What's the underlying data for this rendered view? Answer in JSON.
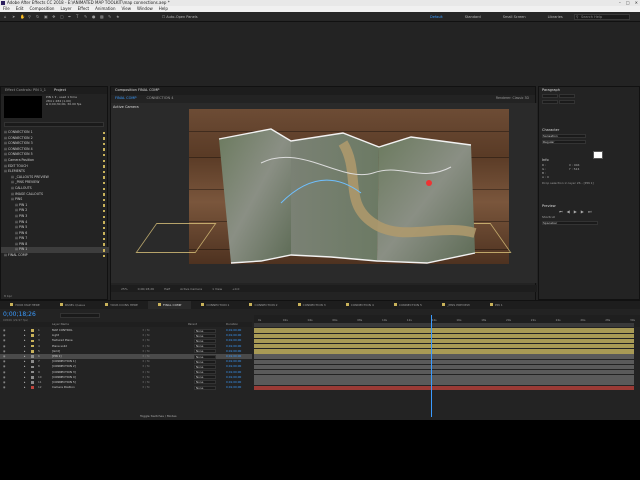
{
  "titlebar": {
    "title": "Adobe After Effects CC 2018 - E:\\ANIMATED MAP TOOLKIT\\map connections.aep *"
  },
  "menubar": [
    "File",
    "Edit",
    "Composition",
    "Layer",
    "Effect",
    "Animation",
    "View",
    "Window",
    "Help"
  ],
  "toolbar": {
    "auto_open": "Auto-Open Panels",
    "workspaces": [
      "Default",
      "Standard",
      "Small Screen",
      "Libraries"
    ],
    "search_placeholder": "Search Help"
  },
  "project_panel": {
    "tabs": [
      "Effect Controls: PIN 1_1",
      "Project"
    ],
    "info": [
      "PIN 1 ▾ , used 1 time",
      "284 x 284 (1.00)",
      "Δ 0;00;30;00, 30.00 fps"
    ],
    "items": [
      "CONNECTION 1",
      "CONNECTION 2",
      "CONNECTION 3",
      "CONNECTION 4",
      "CONNECTION 5",
      "Camera Position",
      "EDIT TOUCH",
      "ELEMENTS",
      "_CALLOUTS PREVIEW",
      "_PINS PREVIEW",
      "CALLOUTS",
      "IMAGE CALLOUTS",
      "PINS",
      "PIN 1",
      "PIN 2",
      "PIN 3",
      "PIN 4",
      "PIN 5",
      "PIN 6",
      "PIN 7",
      "PIN 8",
      "PIN 1",
      "FINAL COMP"
    ],
    "selected_index": 21,
    "bpc": "8 bpc"
  },
  "composition": {
    "tab": "Composition FINAL COMP",
    "subtabs": [
      "FINAL COMP",
      "CONNECTION 4"
    ],
    "renderer": "Renderer:",
    "renderer_value": "Classic 3D",
    "camera_label": "Active Camera",
    "controls": [
      "25%",
      "0;00;18;26",
      "Half",
      "Active Camera",
      "1 View",
      "+0.0"
    ]
  },
  "right_panel": {
    "paragraph": "Paragraph",
    "character": "Character",
    "character_font": "Sansation",
    "character_style": "Regular",
    "info": "Info",
    "info_values": [
      "R :",
      "G :",
      "B :",
      "A : 0",
      "X : 904",
      "Y : 524"
    ],
    "info_note": "Drop selection in layer 26 - [PIN 1]",
    "preview": "Preview",
    "shortcut_label": "Shortcut",
    "shortcut_value": "Spacebar"
  },
  "timeline": {
    "tabs": [
      "YOUR MAP HERE",
      "PANEL Queue",
      "YOUR ICONS HERE",
      "FINAL COMP",
      "CONNECTION 1",
      "CONNECTION 2",
      "CONNECTION 3",
      "CONNECTION 4",
      "CONNECTION 5",
      "_PINS PREVIEW",
      "PIN 1"
    ],
    "active_tab": 3,
    "timecode": "0;00;18;26",
    "timecode_sub": "00566 (29.97 fps)",
    "col_name": "Layer Name",
    "col_parent": "Parent",
    "col_duration": "Duration",
    "layers": [
      {
        "num": "1",
        "name": "MAP CONTROL",
        "color": "#c9b25a",
        "parent": "None",
        "dur": "0;01;00;00"
      },
      {
        "num": "2",
        "name": "Light",
        "color": "#c9b25a",
        "parent": "None",
        "dur": "0;01;00;00"
      },
      {
        "num": "3",
        "name": "Textured Plane",
        "color": "#c9b25a",
        "parent": "None",
        "dur": "0;01;00;00"
      },
      {
        "num": "4",
        "name": "Plane solid",
        "color": "#c9b25a",
        "parent": "None",
        "dur": "0;01;00;00"
      },
      {
        "num": "5",
        "name": "[Grid]",
        "color": "#c9b25a",
        "parent": "None",
        "dur": "0;01;00;00"
      },
      {
        "num": "6",
        "name": "[PIN 1]",
        "color": "#8c8c8c",
        "parent": "None",
        "dur": "0;01;00;00"
      },
      {
        "num": "7",
        "name": "[CONNECTION 1]",
        "color": "#8c8c8c",
        "parent": "None",
        "dur": "0;01;00;00"
      },
      {
        "num": "8",
        "name": "[CONNECTION 2]",
        "color": "#8c8c8c",
        "parent": "None",
        "dur": "0;01;00;00"
      },
      {
        "num": "9",
        "name": "[CONNECTION 3]",
        "color": "#8c8c8c",
        "parent": "None",
        "dur": "0;01;00;00"
      },
      {
        "num": "10",
        "name": "[CONNECTION 4]",
        "color": "#8c8c8c",
        "parent": "None",
        "dur": "0;01;00;00"
      },
      {
        "num": "11",
        "name": "[CONNECTION 5]",
        "color": "#8c8c8c",
        "parent": "None",
        "dur": "0;01;00;00"
      },
      {
        "num": "12",
        "name": "Camera Position",
        "color": "#c2453d",
        "parent": "None",
        "dur": "0;01;00;00"
      }
    ],
    "selected_layer": 5,
    "ruler_ticks": [
      "0s",
      "02s",
      "04s",
      "06s",
      "08s",
      "10s",
      "12s",
      "14s",
      "16s",
      "18s",
      "20s",
      "22s",
      "24s",
      "26s",
      "28s",
      "30s"
    ],
    "toggle_label": "Toggle Switches / Modes"
  }
}
